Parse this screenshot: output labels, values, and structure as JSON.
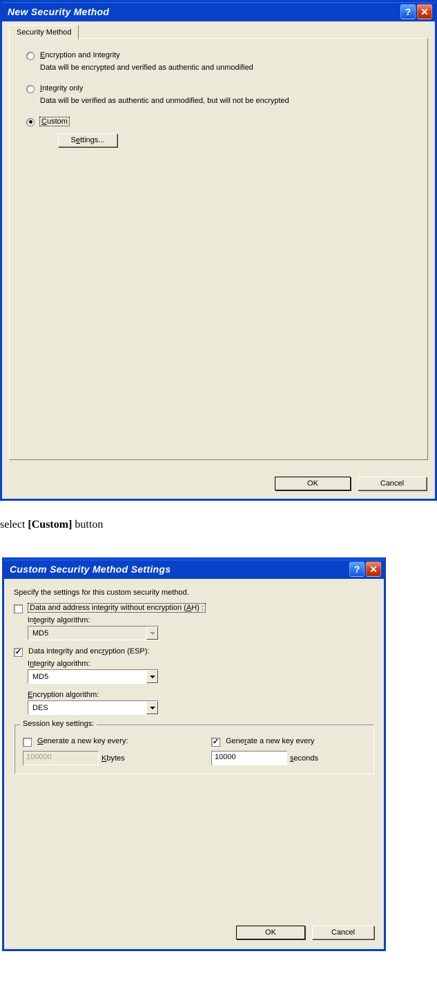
{
  "dialog1": {
    "title": "New Security Method",
    "tab_label": "Security Method",
    "opt_encrypt": {
      "label_pre": "",
      "hot": "E",
      "label_post": "ncryption and Integrity",
      "desc": "Data will be encrypted and verified as authentic and unmodified"
    },
    "opt_integrity": {
      "hot": "I",
      "label_post": "ntegrity only",
      "desc": "Data will be verified as authentic and unmodified, but will not be encrypted"
    },
    "opt_custom": {
      "hot": "C",
      "label_post": "ustom"
    },
    "settings_pre": "S",
    "settings_hot": "e",
    "settings_post": "ttings...",
    "ok": "OK",
    "cancel": "Cancel"
  },
  "instruction_plain_pre": "select ",
  "instruction_bold": "[Custom]",
  "instruction_plain_post": " button",
  "dialog2": {
    "title": "Custom Security Method Settings",
    "intro": "Specify the settings for this custom security method.",
    "ah_pre": "Data and address integrity without encryption (",
    "ah_hot": "A",
    "ah_post": "H) :",
    "ah_int_label_pre": "In",
    "ah_int_hot": "t",
    "ah_int_label_post": "egrity algorithm:",
    "ah_int_value": "MD5",
    "esp_pre": "Data integrity and enc",
    "esp_hot": "r",
    "esp_post": "yption (ESP):",
    "esp_int_label_pre": "I",
    "esp_int_hot": "n",
    "esp_int_label_post": "tegrity algorithm:",
    "esp_int_value": "MD5",
    "esp_enc_label_pre": "",
    "esp_enc_hot": "E",
    "esp_enc_label_post": "ncryption algorithm:",
    "esp_enc_value": "DES",
    "group_title": "Session key settings:",
    "kb_label_pre": "",
    "kb_hot": "G",
    "kb_label_post": "enerate a new key every:",
    "kb_value": "100000",
    "kb_unit_hot": "K",
    "kb_unit_post": "bytes",
    "sec_label_pre": "Gene",
    "sec_hot": "r",
    "sec_label_post": "ate a new key every",
    "sec_value": "10000",
    "sec_unit_hot": "s",
    "sec_unit_post": "econds",
    "ok": "OK",
    "cancel": "Cancel"
  }
}
